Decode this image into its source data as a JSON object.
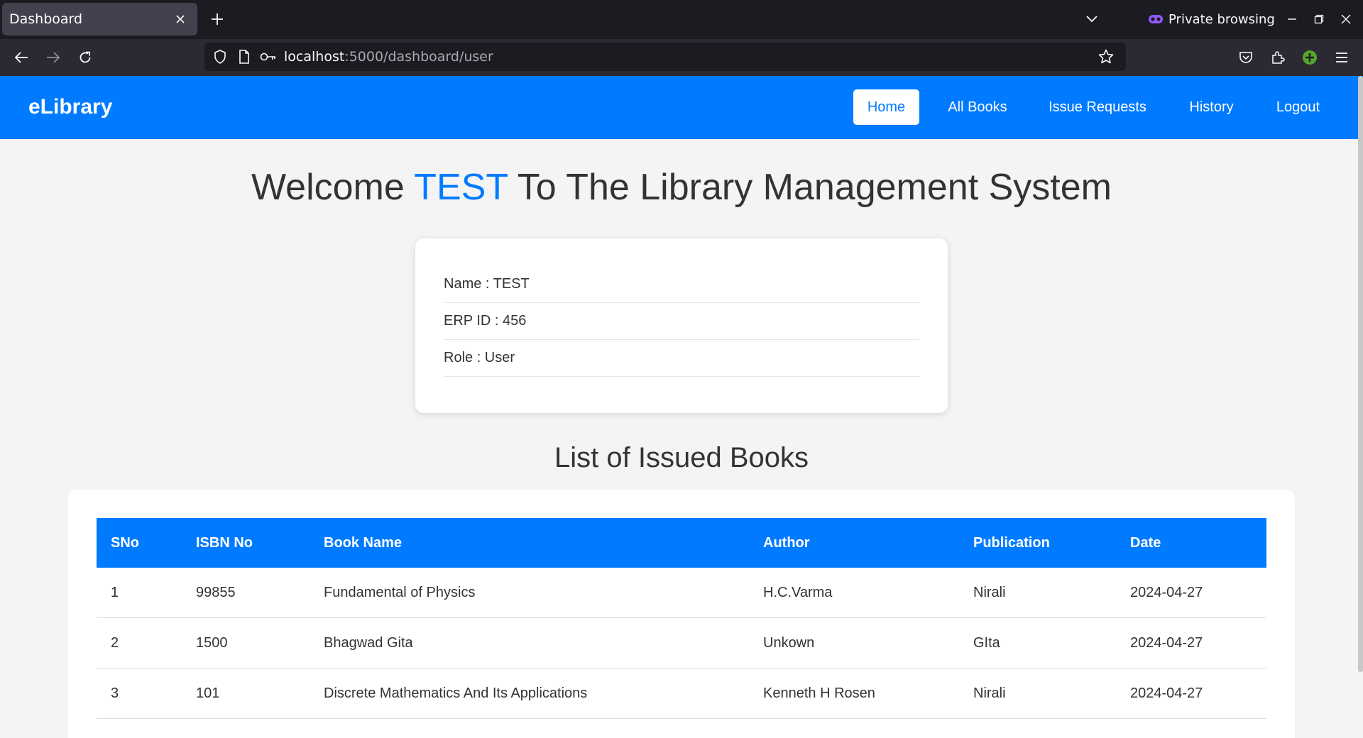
{
  "browser": {
    "tab_title": "Dashboard",
    "private_label": "Private browsing",
    "url_host": "localhost",
    "url_path": ":5000/dashboard/user"
  },
  "site": {
    "brand": "eLibrary",
    "nav": [
      {
        "label": "Home",
        "active": true
      },
      {
        "label": "All Books"
      },
      {
        "label": "Issue Requests"
      },
      {
        "label": "History"
      },
      {
        "label": "Logout"
      }
    ]
  },
  "welcome": {
    "prefix": "Welcome ",
    "name": "TEST",
    "suffix": " To The Library Management System"
  },
  "profile": {
    "name_line": "Name : TEST",
    "erp_line": "ERP ID : 456",
    "role_line": "Role : User"
  },
  "issued": {
    "title": "List of Issued Books",
    "headers": [
      "SNo",
      "ISBN No",
      "Book Name",
      "Author",
      "Publication",
      "Date"
    ],
    "rows": [
      [
        "1",
        "99855",
        "Fundamental of Physics",
        "H.C.Varma",
        "Nirali",
        "2024-04-27"
      ],
      [
        "2",
        "1500",
        "Bhagwad Gita",
        "Unkown",
        "GIta",
        "2024-04-27"
      ],
      [
        "3",
        "101",
        "Discrete Mathematics And Its Applications",
        "Kenneth H Rosen",
        "Nirali",
        "2024-04-27"
      ]
    ]
  },
  "colors": {
    "primary": "#007bff",
    "page_bg": "#f4f4f4",
    "chrome_dark": "#1c1b22",
    "private_accent": "#9059ff",
    "extension_green": "#54a52a"
  }
}
